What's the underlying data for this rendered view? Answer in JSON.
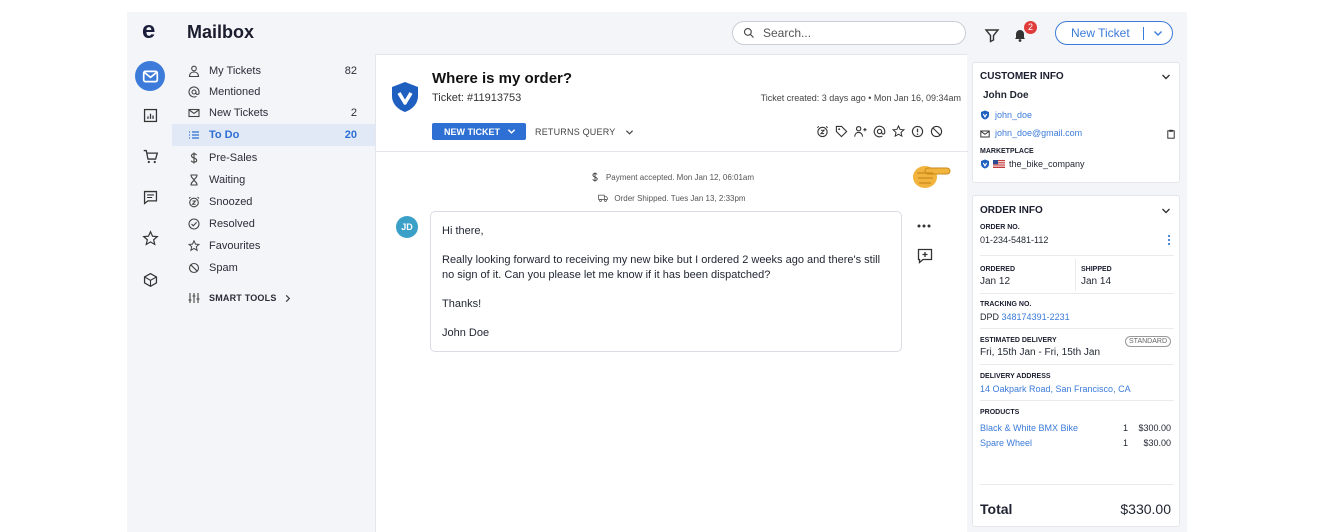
{
  "app": {
    "logo": "e",
    "title": "Mailbox"
  },
  "rail": {
    "items": [
      {
        "icon": "mail-icon",
        "active": true
      },
      {
        "icon": "chart-icon"
      },
      {
        "icon": "cart-icon"
      },
      {
        "icon": "chat-icon"
      },
      {
        "icon": "star-icon"
      },
      {
        "icon": "box-icon"
      }
    ]
  },
  "header": {
    "search_placeholder": "Search...",
    "notification_count": "2",
    "new_ticket_label": "New Ticket"
  },
  "nav": {
    "items": [
      {
        "label": "My Tickets",
        "count": "82",
        "icon": "user-icon"
      },
      {
        "label": "Mentioned",
        "count": "",
        "icon": "at-icon"
      },
      {
        "label": "New Tickets",
        "count": "2",
        "icon": "envelope-icon"
      },
      {
        "label": "To Do",
        "count": "20",
        "icon": "list-icon",
        "active": true
      },
      {
        "label": "Pre-Sales",
        "count": "",
        "icon": "dollar-icon"
      },
      {
        "label": "Waiting",
        "count": "",
        "icon": "hourglass-icon"
      },
      {
        "label": "Snoozed",
        "count": "",
        "icon": "alarm-icon"
      },
      {
        "label": "Resolved",
        "count": "",
        "icon": "check-circle-icon"
      },
      {
        "label": "Favourites",
        "count": "",
        "icon": "star-icon"
      },
      {
        "label": "Spam",
        "count": "",
        "icon": "ban-icon"
      }
    ],
    "smart_tools": "SMART TOOLS"
  },
  "ticket": {
    "title": "Where is my order?",
    "number": "Ticket: #11913753",
    "created": "Ticket created: 3 days ago  •  Mon Jan 16, 09:34am",
    "new_ticket_pill": "NEW TICKET",
    "returns_query": "RETURNS QUERY",
    "events": [
      "Payment accepted. Mon Jan 12, 06:01am",
      "Order Shipped. Tues Jan 13, 2:33pm"
    ],
    "avatar_initials": "JD",
    "message": [
      "Hi there,",
      "Really looking forward to receiving my new bike but I ordered 2 weeks ago and there's still no sign of it. Can you please let me know if it has been dispatched?",
      "Thanks!",
      "John Doe"
    ]
  },
  "customer": {
    "heading": "CUSTOMER INFO",
    "name": "John Doe",
    "username": "john_doe",
    "email": "john_doe@gmail.com",
    "marketplace_label": "MARKETPLACE",
    "marketplace": "the_bike_company"
  },
  "order": {
    "heading": "ORDER INFO",
    "order_no_label": "ORDER NO.",
    "order_no": "01-234-5481-112",
    "ordered_label": "ORDERED",
    "ordered": "Jan 12",
    "shipped_label": "SHIPPED",
    "shipped": "Jan 14",
    "tracking_label": "TRACKING NO.",
    "tracking_carrier": "DPD",
    "tracking_no": "348174391-2231",
    "est_label": "ESTIMATED DELIVERY",
    "est_badge": "STANDARD",
    "est_value": "Fri, 15th Jan - Fri, 15th Jan",
    "address_label": "DELIVERY ADDRESS",
    "address": "14 Oakpark Road, San Francisco, CA",
    "products_label": "PRODUCTS",
    "products": [
      {
        "name": "Black & White BMX Bike",
        "qty": "1",
        "price": "$300.00"
      },
      {
        "name": "Spare Wheel",
        "qty": "1",
        "price": "$30.00"
      }
    ],
    "total_label": "Total",
    "total": "$330.00"
  },
  "colors": {
    "accent": "#3c7bd9",
    "badge": "#e03c3c",
    "active_bg": "#e1e9f7"
  }
}
